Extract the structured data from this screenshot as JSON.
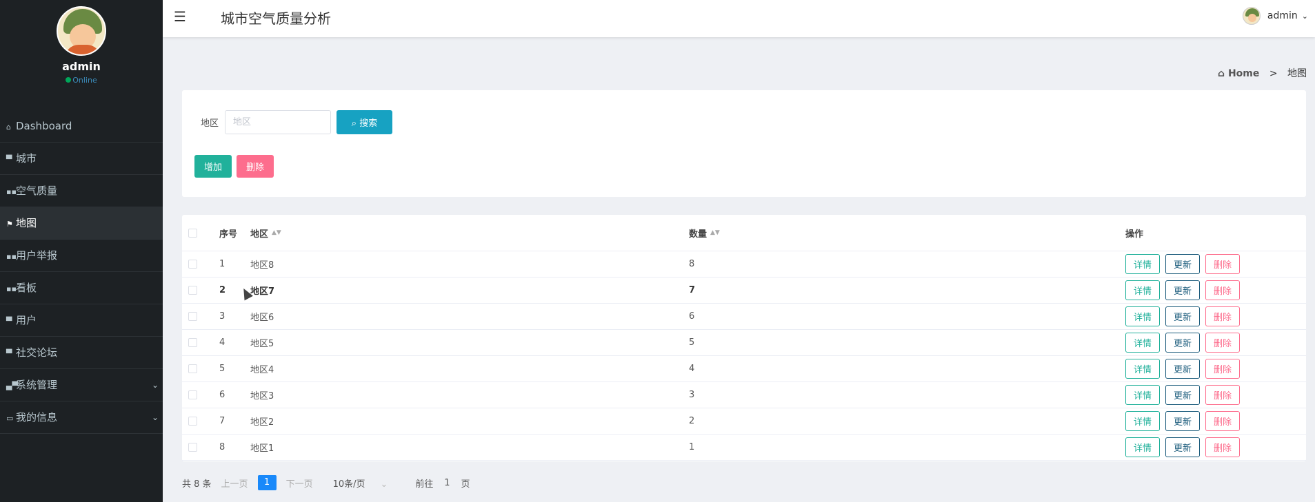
{
  "app_title": "城市空气质量分析",
  "sidebar": {
    "user_name": "admin",
    "status": "Online",
    "items": [
      {
        "icon": "home-icon",
        "glyph": "⌂",
        "label": "Dashboard"
      },
      {
        "icon": "tag-icon",
        "glyph": "▀",
        "label": "城市"
      },
      {
        "icon": "grid-icon",
        "glyph": "▪▪",
        "label": "空气质量"
      },
      {
        "icon": "flag-icon",
        "glyph": "⚑",
        "label": "地图"
      },
      {
        "icon": "grid-icon",
        "glyph": "▪▪",
        "label": "用户举报"
      },
      {
        "icon": "grid-icon",
        "glyph": "▪▪",
        "label": "看板"
      },
      {
        "icon": "tag-icon",
        "glyph": "▀",
        "label": "用户"
      },
      {
        "icon": "tag-icon",
        "glyph": "▀",
        "label": "社交论坛"
      },
      {
        "icon": "keyboard-icon",
        "glyph": "▄▀",
        "label": "系统管理"
      },
      {
        "icon": "card-icon",
        "glyph": "▭",
        "label": "我的信息"
      }
    ],
    "active_index": 3
  },
  "header": {
    "hamburger_glyph": "☰",
    "user_name": "admin",
    "chevron": "⌄"
  },
  "breadcrumb": {
    "home_glyph": "⌂",
    "home": "Home",
    "separator": ">",
    "current": "地图"
  },
  "filter": {
    "label": "地区",
    "placeholder": "地区",
    "search_label": "⌕ 搜索",
    "add_label": "增加",
    "delete_label": "删除"
  },
  "table": {
    "columns": {
      "index": "序号",
      "region": "地区",
      "count": "数量",
      "actions": "操作"
    },
    "sort_glyph": "▲▼",
    "rows": [
      {
        "index": "1",
        "region": "地区8",
        "count": "8"
      },
      {
        "index": "2",
        "region": "地区7",
        "count": "7"
      },
      {
        "index": "3",
        "region": "地区6",
        "count": "6"
      },
      {
        "index": "4",
        "region": "地区5",
        "count": "5"
      },
      {
        "index": "5",
        "region": "地区4",
        "count": "4"
      },
      {
        "index": "6",
        "region": "地区3",
        "count": "3"
      },
      {
        "index": "7",
        "region": "地区2",
        "count": "2"
      },
      {
        "index": "8",
        "region": "地区1",
        "count": "1"
      }
    ],
    "hovered_row": 1,
    "action_labels": {
      "detail": "详情",
      "update": "更新",
      "delete": "删除"
    }
  },
  "pagination": {
    "total": "共 8 条",
    "prev": "上一页",
    "current_page": "1",
    "next": "下一页",
    "page_size": "10条/页",
    "page_size_caret": "⌄",
    "goto_label": "前往",
    "goto_value": "1",
    "page_suffix": "页"
  }
}
